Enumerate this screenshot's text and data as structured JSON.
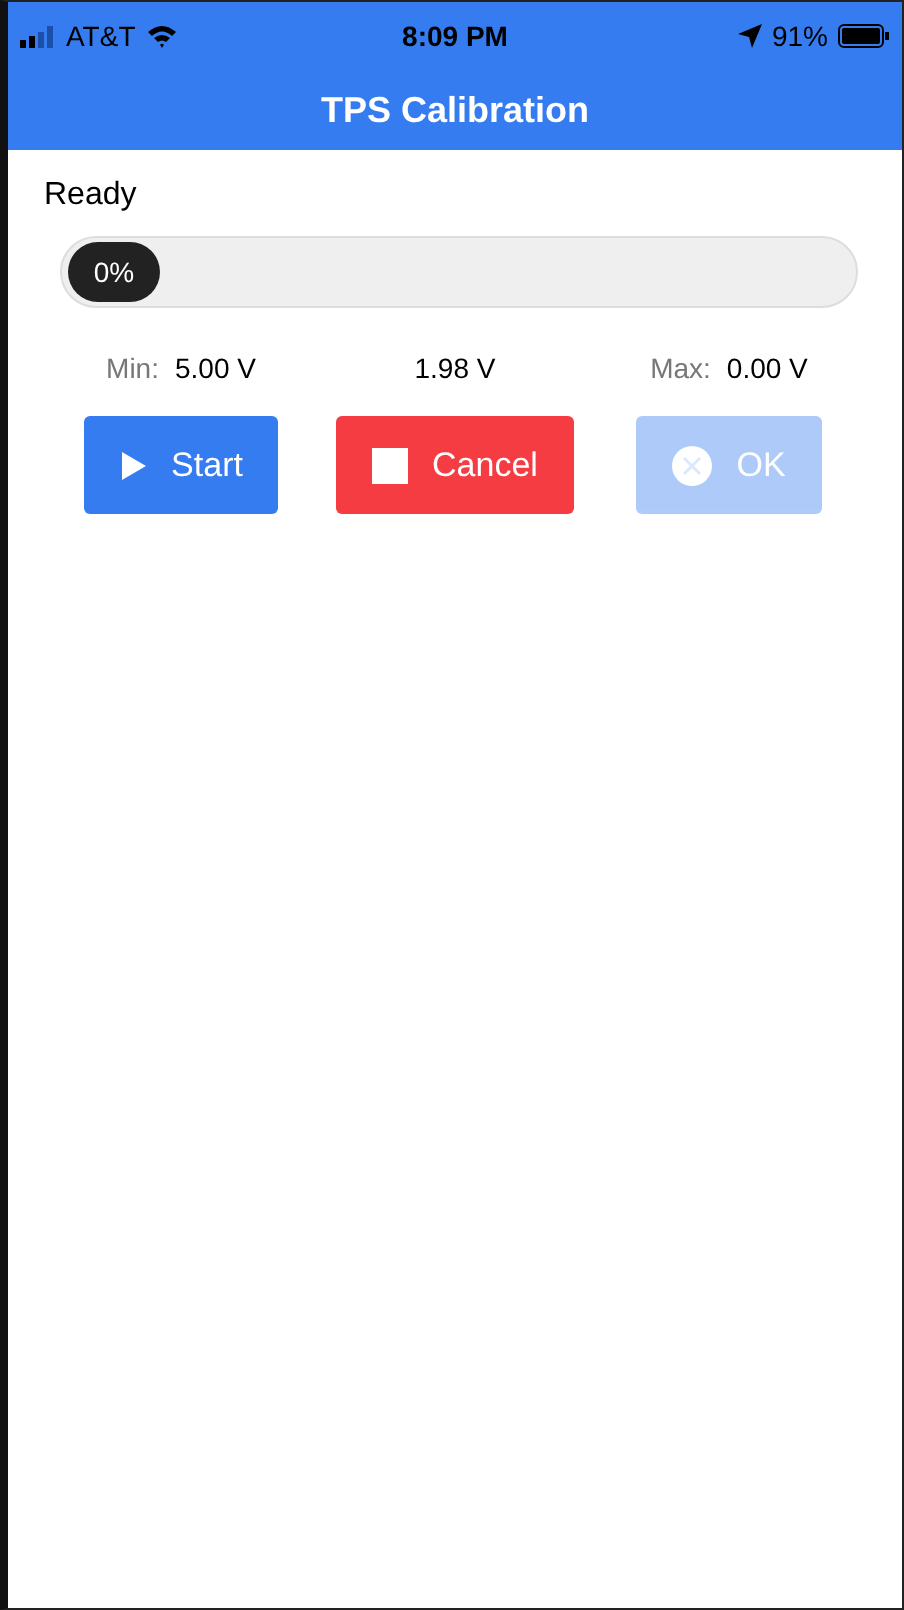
{
  "status_bar": {
    "carrier": "AT&T",
    "time": "8:09 PM",
    "battery": "91%"
  },
  "nav_bar": {
    "title": "TPS Calibration"
  },
  "status_text": "Ready",
  "progress": {
    "level": 0,
    "reading": "0%"
  },
  "readings": [
    {
      "label": "Min:",
      "value": "5.00 V"
    },
    {
      "value": "1.98 V"
    },
    {
      "label": "Max:",
      "value": "0.00 V"
    }
  ],
  "buttons": [
    {
      "kind": "start",
      "label": "Start",
      "disabled": false
    },
    {
      "kind": "cancel",
      "label": "Cancel",
      "disabled": false
    },
    {
      "kind": "ok",
      "label": "OK",
      "disabled": true
    }
  ]
}
